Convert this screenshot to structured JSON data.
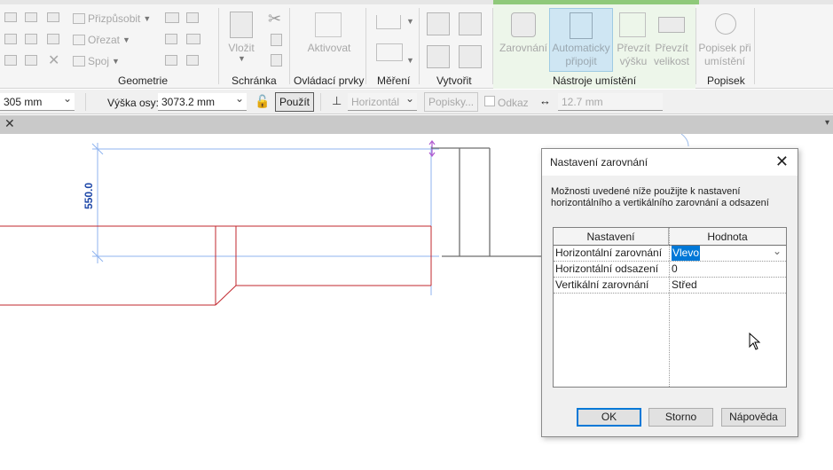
{
  "ribbon": {
    "geometrie": {
      "label": "Geometrie",
      "items": [
        "Přizpůsobit",
        "Ořezat",
        "Spoj"
      ]
    },
    "schranka": {
      "label": "Schránka",
      "vlozit": "Vložit"
    },
    "ovladaci_prvky": {
      "label": "Ovládací prvky",
      "aktivovat": "Aktivovat"
    },
    "mereni": {
      "label": "Měření"
    },
    "vytvorit": {
      "label": "Vytvořit"
    },
    "nastroje_umisteni": {
      "label": "Nástroje umístění",
      "zarovnani": "Zarovnání",
      "automaticky": "Automaticky",
      "pripojit": "připojit",
      "prevzit": "Převzít",
      "vysku": "výšku",
      "velikost": "velikost"
    },
    "popisek": {
      "label": "Popisek",
      "popisek_pri": "Popisek při",
      "umisteni": "umístění"
    }
  },
  "options_bar": {
    "width_value": "305 mm",
    "axis_height_label": "Výška osy:",
    "axis_height_value": "3073.2 mm",
    "apply_button": "Použít",
    "horizontal_select": "Horizontál",
    "labels_button": "Popisky...",
    "reference_checkbox_label": "Odkaz",
    "offset_value": "12.7 mm"
  },
  "tab_bar": {
    "close_glyph": "✕",
    "menu_glyph": "▾"
  },
  "canvas": {
    "dimension_text": "550.0"
  },
  "dialog": {
    "title": "Nastavení zarovnání",
    "close_glyph": "✕",
    "description": "Možnosti uvedené níže použijte k nastavení horizontálního a vertikálního zarovnání a odsazení",
    "columns": [
      "Nastavení",
      "Hodnota"
    ],
    "rows": [
      {
        "setting": "Horizontální zarovnání",
        "value": "Vlevo"
      },
      {
        "setting": "Horizontální odsazení",
        "value": "0"
      },
      {
        "setting": "Vertikální zarovnání",
        "value": "Střed"
      }
    ],
    "buttons": {
      "ok": "OK",
      "cancel": "Storno",
      "help": "Nápověda"
    }
  },
  "colors": {
    "accent": "#0078d7",
    "dimension_line": "#7fa7e8",
    "element_red": "#c1272d",
    "context_tab_green": "#8fc97a"
  }
}
